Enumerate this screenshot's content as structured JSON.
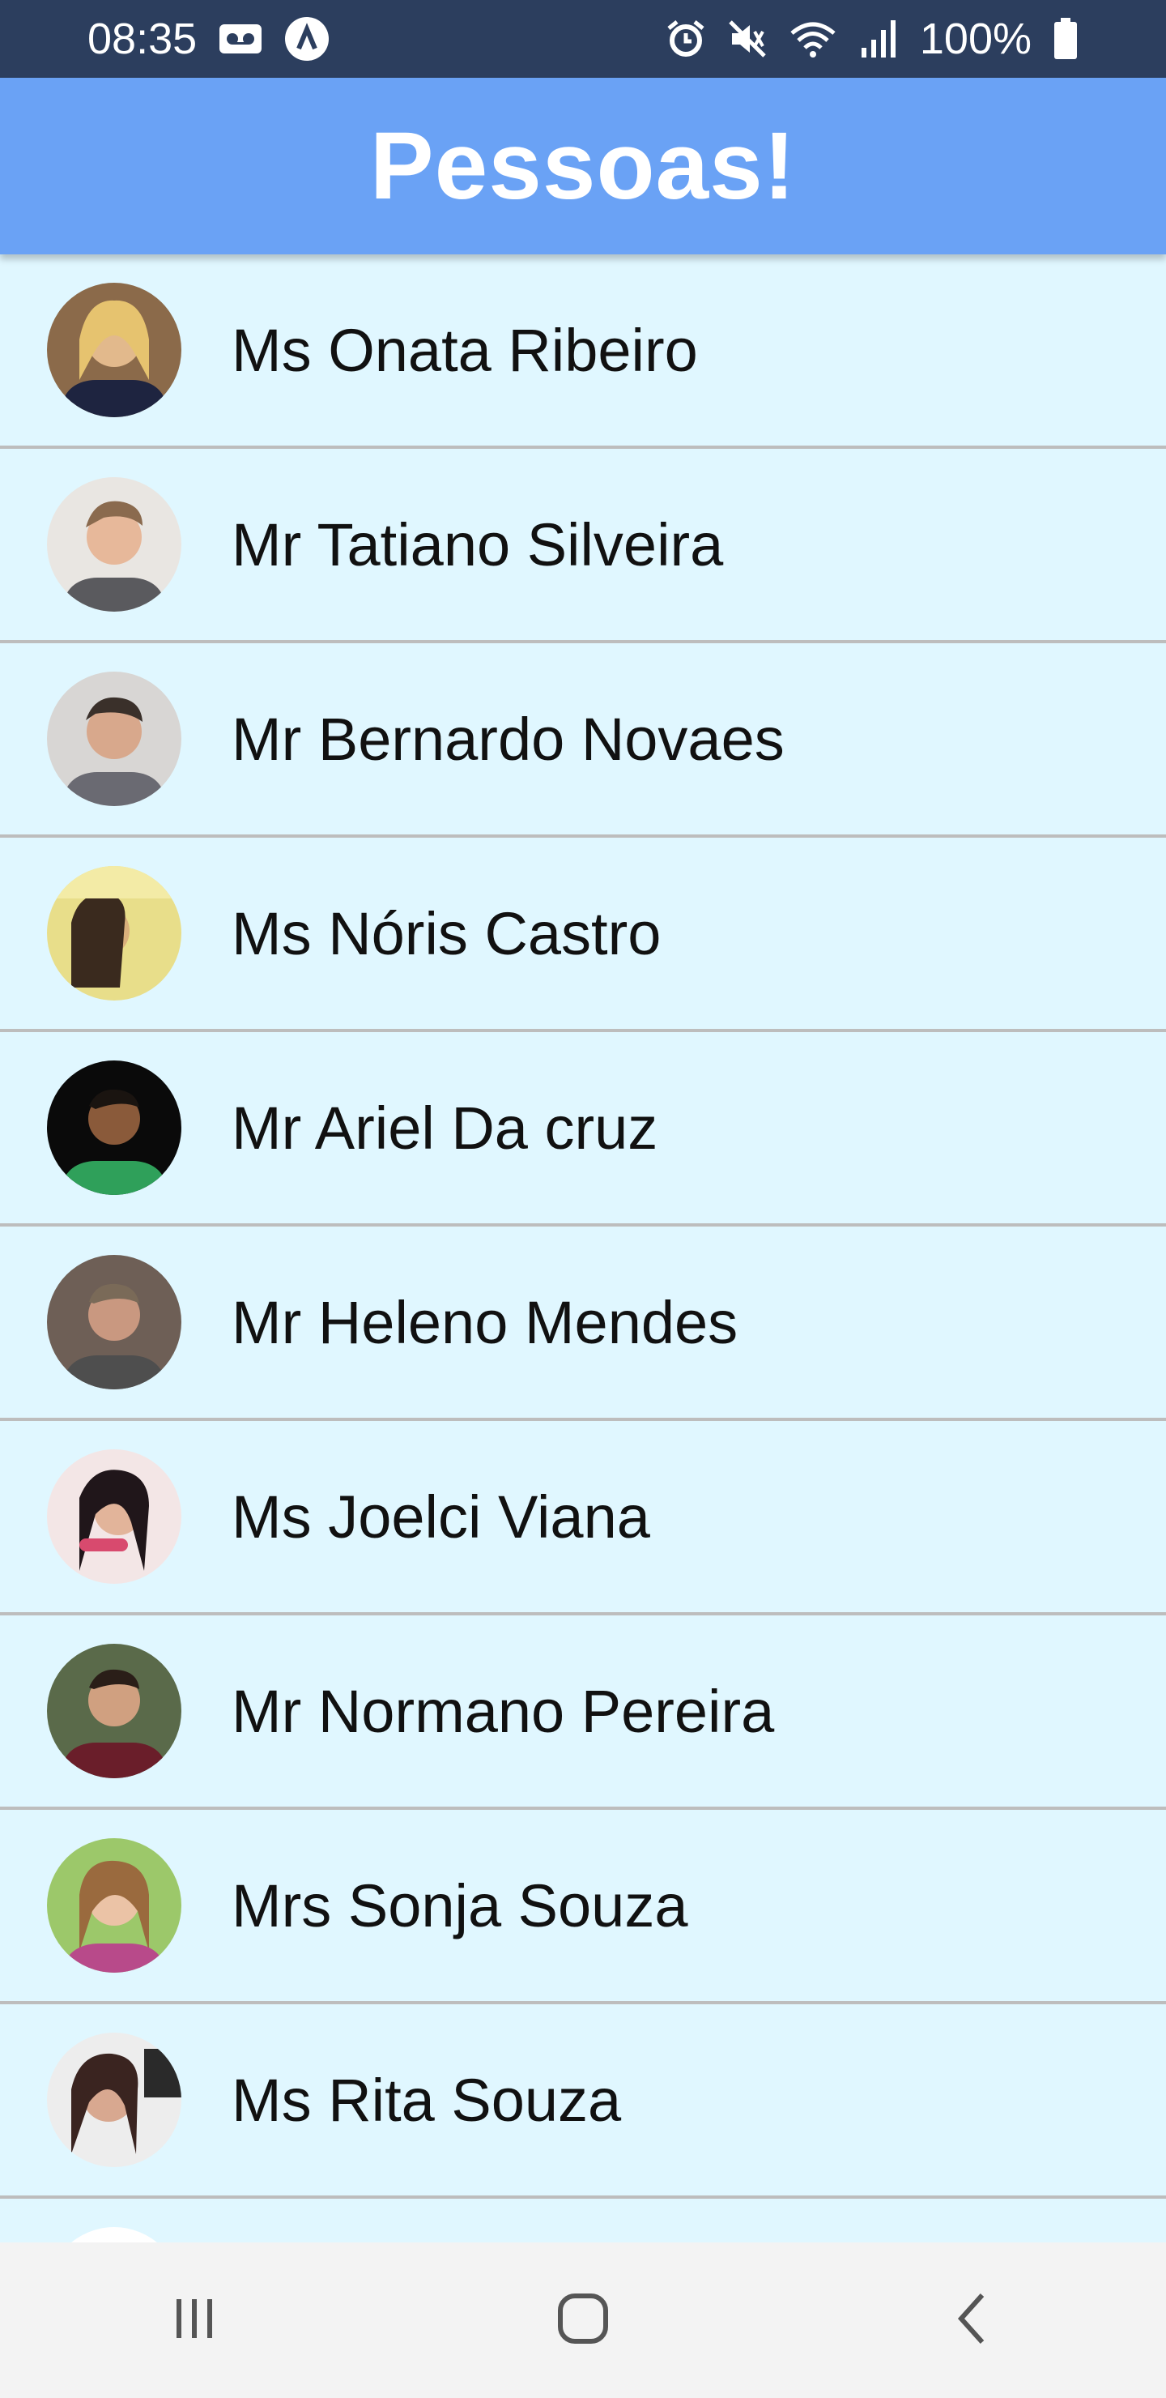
{
  "status_bar": {
    "time": "08:35",
    "battery": "100%",
    "icons": [
      "voicemail-icon",
      "app-a-icon",
      "alarm-icon",
      "mute-icon",
      "wifi-icon",
      "signal-icon",
      "battery-icon"
    ]
  },
  "header": {
    "title": "Pessoas!"
  },
  "colors": {
    "status_bar": "#2C3E5E",
    "header": "#6AA2F5",
    "list_bg": "#E0F7FF",
    "divider": "#BDBDBD",
    "nav_bar": "#F3F3F3"
  },
  "people": [
    {
      "name": "Ms Onata Ribeiro"
    },
    {
      "name": "Mr Tatiano Silveira"
    },
    {
      "name": "Mr Bernardo Novaes"
    },
    {
      "name": "Ms Nóris Castro"
    },
    {
      "name": "Mr Ariel Da cruz"
    },
    {
      "name": "Mr Heleno Mendes"
    },
    {
      "name": "Ms Joelci Viana"
    },
    {
      "name": "Mr Normano Pereira"
    },
    {
      "name": "Mrs Sonja Souza"
    },
    {
      "name": "Ms Rita Souza"
    },
    {
      "name": ""
    }
  ],
  "nav": {
    "icons": [
      "recent-apps-icon",
      "home-icon",
      "back-icon"
    ]
  }
}
